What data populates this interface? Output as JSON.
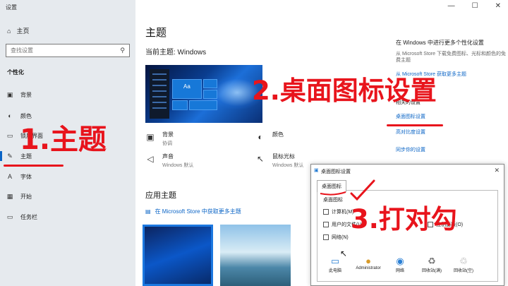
{
  "window": {
    "title": "设置",
    "controls": [
      "—",
      "☐",
      "✕"
    ]
  },
  "sidebar": {
    "home_label": "主页",
    "search_placeholder": "查找设置",
    "section": "个性化",
    "items": [
      {
        "label": "背景",
        "icon": "image-icon"
      },
      {
        "label": "颜色",
        "icon": "palette-icon"
      },
      {
        "label": "锁屏界面",
        "icon": "lockscreen-icon"
      },
      {
        "label": "主题",
        "icon": "brush-icon",
        "active": true
      },
      {
        "label": "字体",
        "icon": "font-icon"
      },
      {
        "label": "开始",
        "icon": "start-icon"
      },
      {
        "label": "任务栏",
        "icon": "taskbar-icon"
      }
    ]
  },
  "main": {
    "title": "主题",
    "current_theme": "当前主题: Windows",
    "preview_label": "Aa",
    "options": [
      {
        "title": "背景",
        "sub": "协调",
        "icon": "image-icon"
      },
      {
        "title": "颜色",
        "sub": "",
        "icon": "palette-icon"
      },
      {
        "title": "声音",
        "sub": "Windows 默认",
        "icon": "speaker-icon"
      },
      {
        "title": "鼠标光标",
        "sub": "Windows 默认",
        "icon": "cursor-icon"
      }
    ],
    "apply_title": "应用主题",
    "store_link": "在 Microsoft Store 中获取更多主题"
  },
  "right_column": {
    "title": "在 Windows 中进行更多个性化设置",
    "subtitle": "从 Microsoft Store 下载免费图标、光标和颜色的免费主题",
    "store_link": "从 Microsoft Store 获取更多主题",
    "related_title": "相关的设置",
    "desktop_icon_settings": "桌面图标设置",
    "high_contrast": "高对比度设置",
    "sync_settings": "同步你的设置"
  },
  "dialog": {
    "title": "桌面图标设置",
    "tab": "桌面图标",
    "group": "桌面图标",
    "checkboxes": [
      {
        "label": "计算机(M)"
      },
      {
        "label": "用户的文件(U)"
      },
      {
        "label": "控制面板(O)"
      },
      {
        "label": "网络(N)"
      }
    ],
    "icons": [
      {
        "label": "此电脑",
        "icon": "computer-icon"
      },
      {
        "label": "Administrator",
        "icon": "user-folder-icon"
      },
      {
        "label": "网络",
        "icon": "network-icon"
      },
      {
        "label": "回收站(满)",
        "icon": "recycle-full-icon"
      },
      {
        "label": "回收站(空)",
        "icon": "recycle-empty-icon"
      }
    ]
  },
  "annotations": {
    "step1": "1.主题",
    "step2": "2.桌面图标设置",
    "step3": "3.打对勾",
    "color": "#e8141c"
  }
}
